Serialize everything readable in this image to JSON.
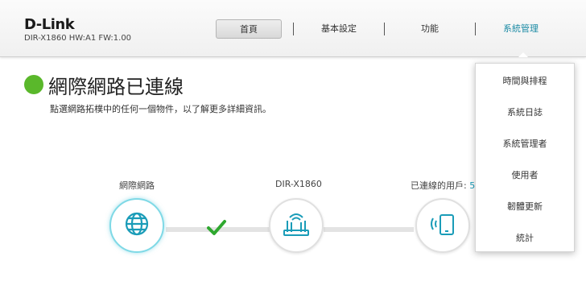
{
  "brand": {
    "logo": "D-Link",
    "model_info": "DIR-X1860 HW:A1 FW:1.00"
  },
  "nav": {
    "tabs": [
      {
        "label": "首頁",
        "active": true
      },
      {
        "label": "基本設定",
        "active": false
      },
      {
        "label": "功能",
        "active": false
      },
      {
        "label": "系統管理",
        "active": false,
        "highlighted": true
      }
    ]
  },
  "status": {
    "title": "網際網路已連線",
    "subtitle": "點選網路拓樸中的任何一個物件，以了解更多詳細資訊。",
    "indicator_color": "#5ab82b"
  },
  "topology": {
    "internet_label": "網際網路",
    "router_label": "DIR-X1860",
    "clients_label": "已連線的用戶:",
    "clients_count": "5",
    "connection_status": "connected"
  },
  "management_menu": {
    "items": [
      "時間與排程",
      "系統日誌",
      "系統管理者",
      "使用者",
      "韌體更新",
      "統計"
    ]
  },
  "colors": {
    "accent": "#1a9cb8",
    "ok_green": "#2fa82f",
    "status_green": "#5ab82b"
  }
}
